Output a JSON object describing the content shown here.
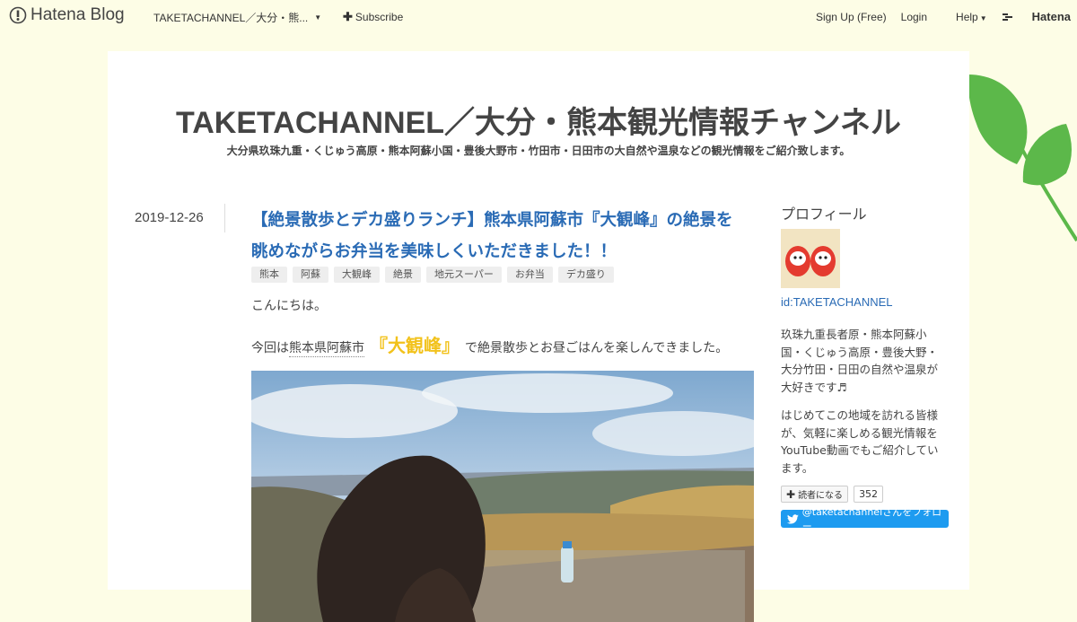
{
  "topbar": {
    "logo_text": "Hatena Blog",
    "blog_name": "TAKETACHANNEL／大分・熊...",
    "subscribe": "Subscribe",
    "signup": "Sign Up (Free)",
    "login": "Login",
    "help": "Help",
    "hatena": "Hatena"
  },
  "blog": {
    "title": "TAKETACHANNEL／大分・熊本観光情報チャンネル",
    "description": "大分県玖珠九重・くじゅう高原・熊本阿蘇小国・豊後大野市・竹田市・日田市の大自然や温泉などの観光情報をご紹介致します。"
  },
  "entry": {
    "date": "2019-12-26",
    "title_line1": "【絶景散歩とデカ盛りランチ】熊本県阿蘇市『大観峰』の絶景を",
    "title_line2": "眺めながらお弁当を美味しくいただきました！！",
    "tags": [
      "熊本",
      "阿蘇",
      "大観峰",
      "絶景",
      "地元スーパー",
      "お弁当",
      "デカ盛り"
    ],
    "greeting": "こんにちは。",
    "intro_prefix": "今回は",
    "intro_link": "熊本県阿蘇市",
    "intro_highlight": "『大観峰』",
    "intro_suffix": "で絶景散歩とお昼ごはんを楽しんできました。"
  },
  "sidebar": {
    "heading": "プロフィール",
    "user_id": "id:TAKETACHANNEL",
    "text1": "玖珠九重長者原・熊本阿蘇小国・くじゅう高原・豊後大野・大分竹田・日田の自然や温泉が大好きです♬",
    "text2": "はじめてこの地域を訪れる皆様が、気軽に楽しめる観光情報をYouTube動画でもご紹介しています。",
    "reader_button": "読者になる",
    "reader_count": "352",
    "twitter_follow": "@taketachannelさんをフォロー"
  },
  "colors": {
    "page_bg": "#fdfde6",
    "link_blue": "#2a6bb5",
    "highlight_yellow": "#f2c21b",
    "twitter_blue": "#1d9bf0",
    "leaf_green": "#5cb84a"
  },
  "icons": [
    "hatena-blog-logo-icon",
    "caret-down-icon",
    "plus-icon",
    "hatena-logo-icon",
    "twitter-bird-icon",
    "leaf-decoration",
    "daruma-avatar"
  ]
}
